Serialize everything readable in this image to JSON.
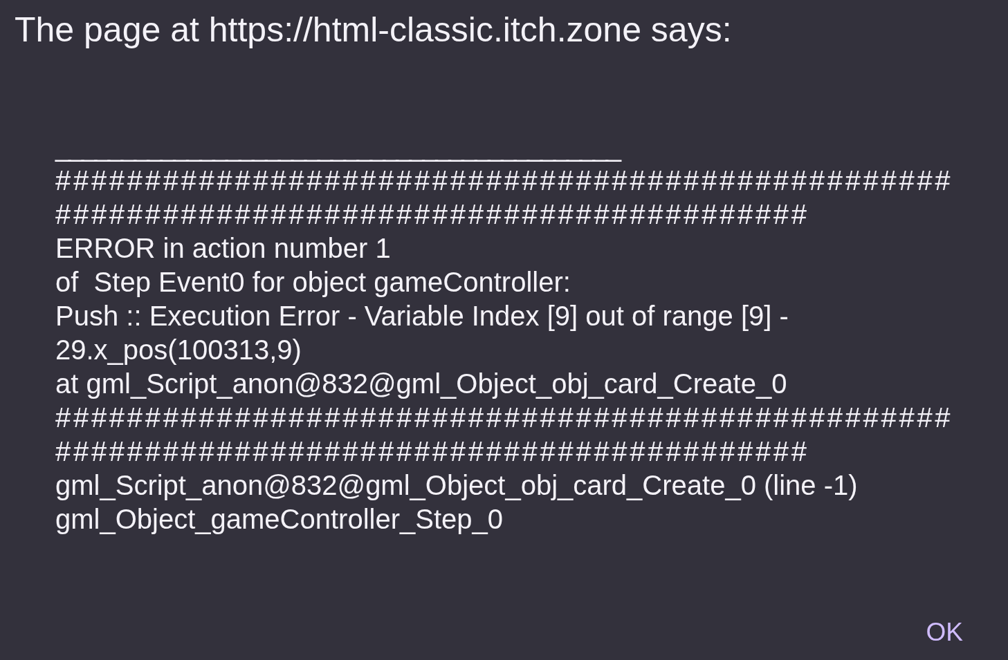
{
  "dialog": {
    "title": "The page at https://html-classic.itch.zone says:",
    "message_lines": [
      {
        "kind": "underscore_rule",
        "text": "___________________________________________"
      },
      {
        "kind": "hash_rule",
        "text": "##################################################"
      },
      {
        "kind": "hash_rule",
        "text": "##########################################"
      },
      {
        "kind": "text",
        "text": "ERROR in action number 1"
      },
      {
        "kind": "text",
        "text": "of  Step Event0 for object gameController:"
      },
      {
        "kind": "text",
        "text": "Push :: Execution Error - Variable Index [9] out of range [9] -"
      },
      {
        "kind": "text",
        "text": "29.x_pos(100313,9)"
      },
      {
        "kind": "text",
        "text": "at gml_Script_anon@832@gml_Object_obj_card_Create_0"
      },
      {
        "kind": "hash_rule",
        "text": "##################################################"
      },
      {
        "kind": "hash_rule",
        "text": "##########################################"
      },
      {
        "kind": "text",
        "text": "gml_Script_anon@832@gml_Object_obj_card_Create_0 (line -1)"
      },
      {
        "kind": "text",
        "text": "gml_Object_gameController_Step_0"
      }
    ],
    "buttons": [
      {
        "label": "OK"
      }
    ]
  }
}
